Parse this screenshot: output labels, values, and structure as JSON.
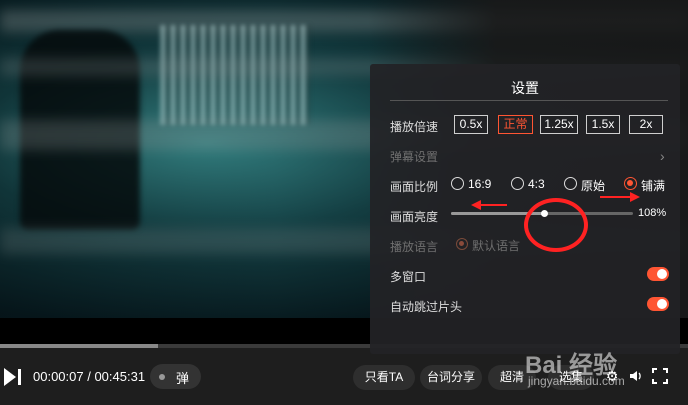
{
  "player": {
    "current_time": "00:00:07",
    "duration": "00:45:31",
    "time_display": "00:00:07 / 00:45:31",
    "progress": 0.23,
    "danmu_label": "弹",
    "buttons": {
      "only_watch": "只看TA",
      "lyric_share": "台词分享",
      "quality": "超清",
      "episodes": "选集"
    },
    "icons": [
      "play-pause-icon",
      "gear-icon",
      "volume-icon",
      "fullscreen-icon"
    ]
  },
  "settings": {
    "title": "设置",
    "speed": {
      "label": "播放倍速",
      "options": [
        "0.5x",
        "正常",
        "1.25x",
        "1.5x",
        "2x"
      ],
      "selected": "正常"
    },
    "danmaku": {
      "label": "弹幕设置"
    },
    "aspect": {
      "label": "画面比例",
      "options": [
        "16:9",
        "4:3",
        "原始",
        "铺满"
      ],
      "selected": "铺满"
    },
    "brightness": {
      "label": "画面亮度",
      "value": 108,
      "value_text": "108%",
      "fraction": 0.51
    },
    "language": {
      "label": "播放语言",
      "option": "默认语言"
    },
    "multi_window": {
      "label": "多窗口",
      "enabled": true
    },
    "skip_intro": {
      "label": "自动跳过片头",
      "enabled": true
    }
  },
  "watermark": {
    "brand": "Bai 经验",
    "url": "jingyan.baidu.com"
  },
  "colors": {
    "accent": "#ff5533",
    "annotation": "#ff2222",
    "panel_bg": "#222226"
  }
}
